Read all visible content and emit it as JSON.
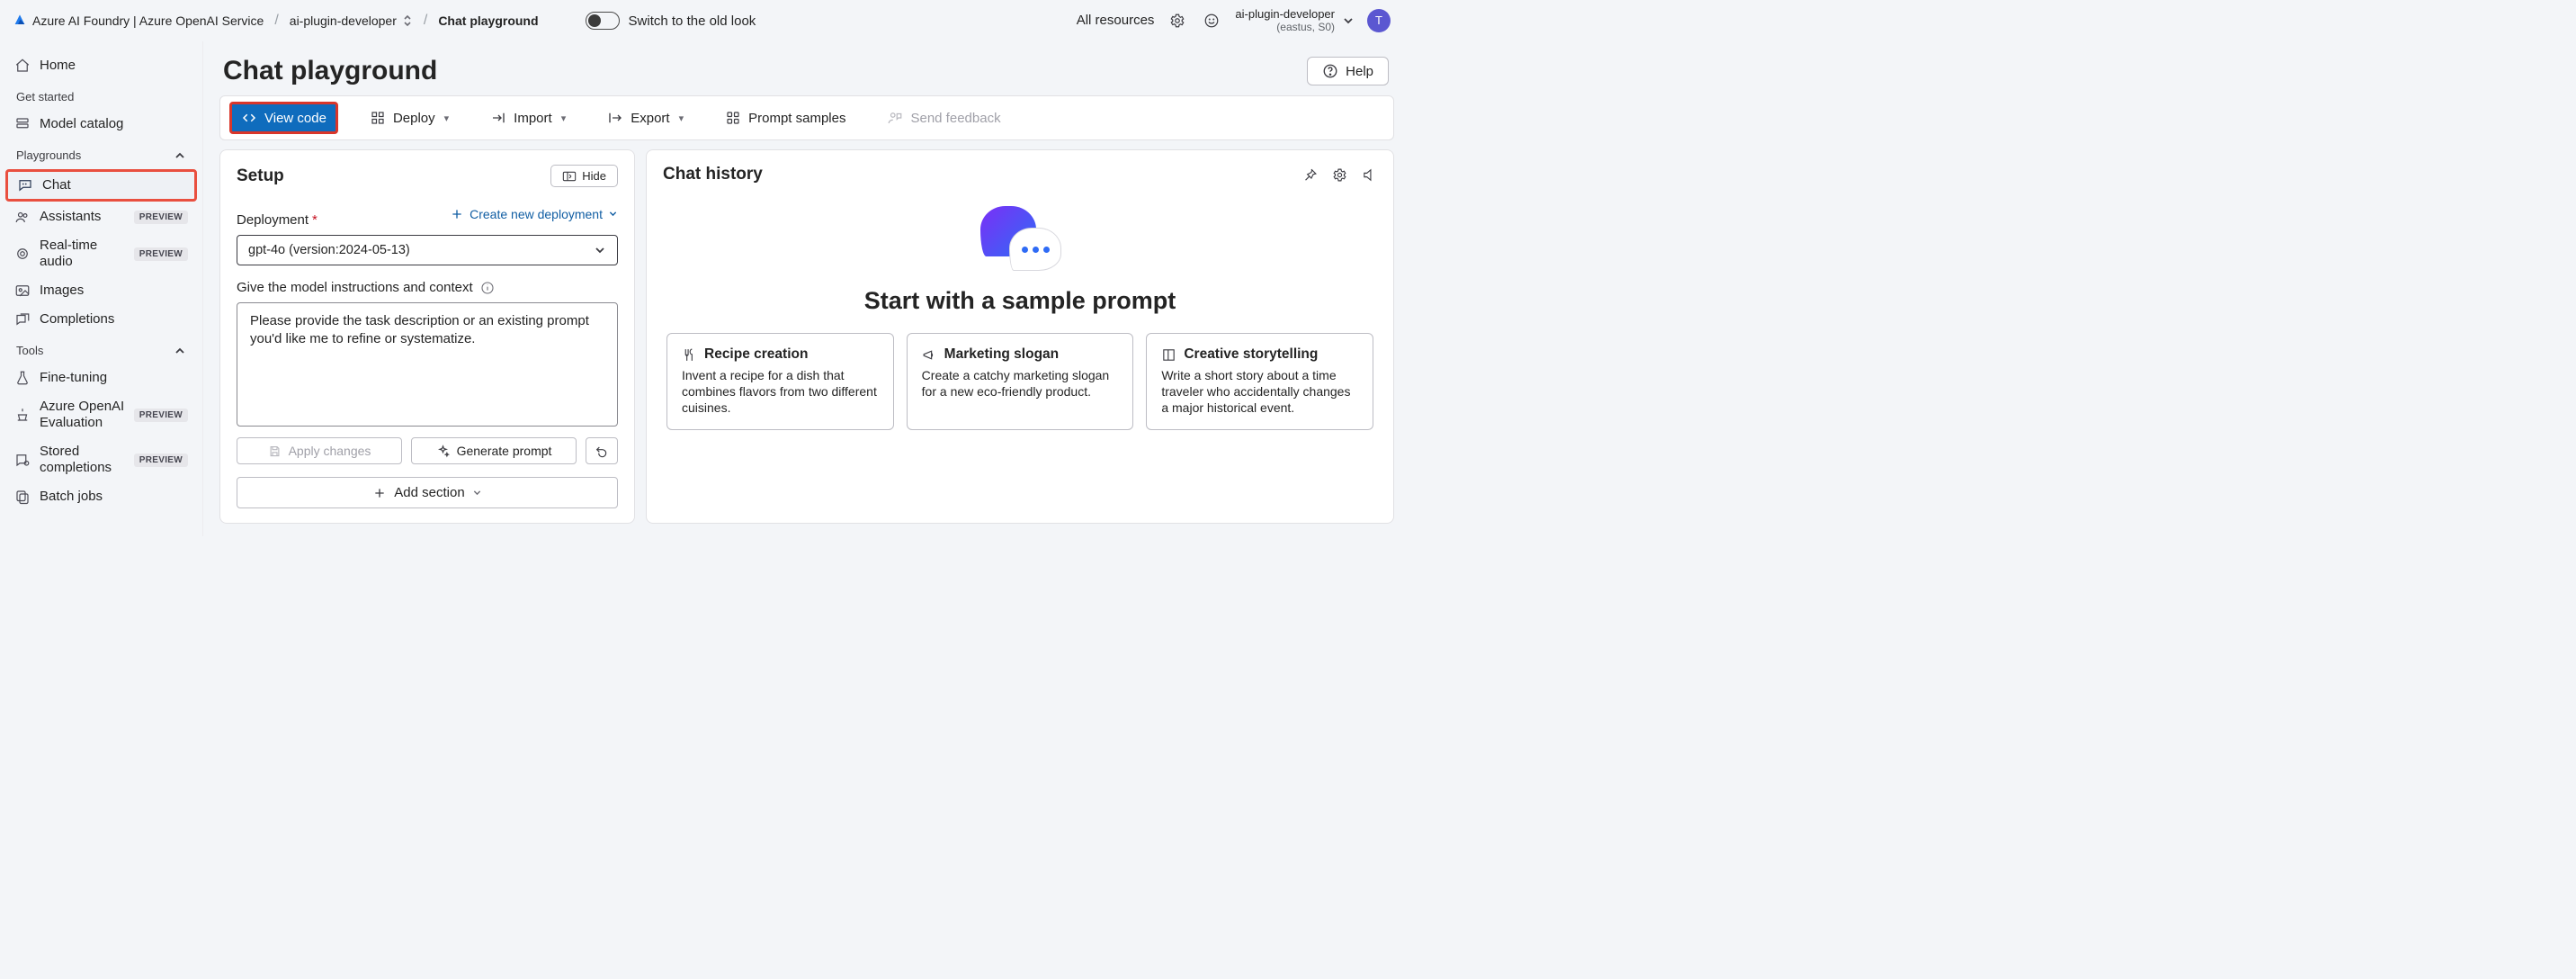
{
  "header": {
    "product": "Azure AI Foundry | Azure OpenAI Service",
    "project": "ai-plugin-developer",
    "page": "Chat playground",
    "switch_label": "Switch to the old look",
    "all_resources": "All resources",
    "tenant_name": "ai-plugin-developer",
    "tenant_sub": "(eastus, S0)",
    "avatar_initial": "T"
  },
  "sidebar": {
    "home": "Home",
    "get_started_heading": "Get started",
    "model_catalog": "Model catalog",
    "playgrounds_heading": "Playgrounds",
    "chat": "Chat",
    "assistants": "Assistants",
    "preview_badge": "PREVIEW",
    "realtime_audio": "Real-time audio",
    "images": "Images",
    "completions": "Completions",
    "tools_heading": "Tools",
    "fine_tuning": "Fine-tuning",
    "evaluation": "Azure OpenAI Evaluation",
    "stored_completions": "Stored completions",
    "batch_jobs": "Batch jobs"
  },
  "page": {
    "title": "Chat playground",
    "help": "Help"
  },
  "cmdbar": {
    "view_code": "View code",
    "deploy": "Deploy",
    "import": "Import",
    "export": "Export",
    "prompt_samples": "Prompt samples",
    "send_feedback": "Send feedback"
  },
  "setup": {
    "title": "Setup",
    "hide": "Hide",
    "deployment_label": "Deployment",
    "create_new": "Create new deployment",
    "deployment_value": "gpt-4o (version:2024-05-13)",
    "instructions_label": "Give the model instructions and context",
    "system_prompt": "Please provide the task description or an existing prompt you'd like me to refine or systematize.",
    "apply_changes": "Apply changes",
    "generate_prompt": "Generate prompt",
    "add_section": "Add section"
  },
  "chat": {
    "title": "Chat history",
    "empty_title": "Start with a sample prompt",
    "cards": [
      {
        "title": "Recipe creation",
        "desc": "Invent a recipe for a dish that combines flavors from two different cuisines."
      },
      {
        "title": "Marketing slogan",
        "desc": "Create a catchy marketing slogan for a new eco-friendly product."
      },
      {
        "title": "Creative storytelling",
        "desc": "Write a short story about a time traveler who accidentally changes a major historical event."
      }
    ]
  }
}
